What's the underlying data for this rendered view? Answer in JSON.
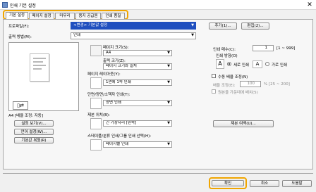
{
  "window": {
    "title": "인쇄 기본 설정",
    "close_label": "✕"
  },
  "tabs": [
    {
      "label": "기본 설정"
    },
    {
      "label": "페이지 설정"
    },
    {
      "label": "마무리"
    },
    {
      "label": "용지 공급원"
    },
    {
      "label": "인쇄 품질"
    }
  ],
  "profile": {
    "label": "프로파일(F):",
    "value": "<변경> 기본값 설정",
    "add_button": "추가(1)...",
    "edit_button": "편집(2)..."
  },
  "output_method": {
    "label": "출력 방법(M):",
    "value": "인쇄"
  },
  "preview": {
    "info_text": "A4 [배율 조정: 자동]",
    "settings_view_button": "설정 보기(V)...",
    "language_button": "언어 설정(W)...",
    "restore_button": "기본값 복원(R)"
  },
  "page_size": {
    "label": "페이지 크기(S):",
    "value": "A4"
  },
  "output_size": {
    "label": "출력 크기(Z):",
    "value": "페이지 크기와 일치"
  },
  "copies": {
    "label": "인쇄 매수(C):",
    "value": "1",
    "range": "[1 ~ 999]"
  },
  "orientation": {
    "label": "인쇄 방향(O)",
    "portrait": "세로 인쇄",
    "landscape": "가로 인쇄",
    "selected": "portrait"
  },
  "page_layout": {
    "label": "페이지 레이아웃(Y):",
    "value": "1면에 1쪽 인쇄"
  },
  "manual_scaling": {
    "label": "수동 배율 조정(N)",
    "checked": false,
    "scaling_label": "배율 조정(E):",
    "scaling_value": "100",
    "scaling_range": "% [25 ~ 200]",
    "booklet_label": "원본을 가운데에 배치(5)"
  },
  "duplex": {
    "label": "단면/양면/소책자 인쇄(T):",
    "value": "양면 인쇄"
  },
  "binding": {
    "label": "제본 위치(B):",
    "value": "긴 가장자리 [왼쪽]",
    "margin_button": "제본 여백(U)..."
  },
  "collate": {
    "label": "스테이플/분류 인쇄/그룹 인쇄 선택(H):",
    "value": "페이지별 인쇄"
  },
  "footer": {
    "ok": "확인",
    "cancel": "취소",
    "help": "도움말"
  },
  "colors": {
    "accent_highlight": "#f0a500",
    "profile_blue": "#1f4fbf"
  }
}
